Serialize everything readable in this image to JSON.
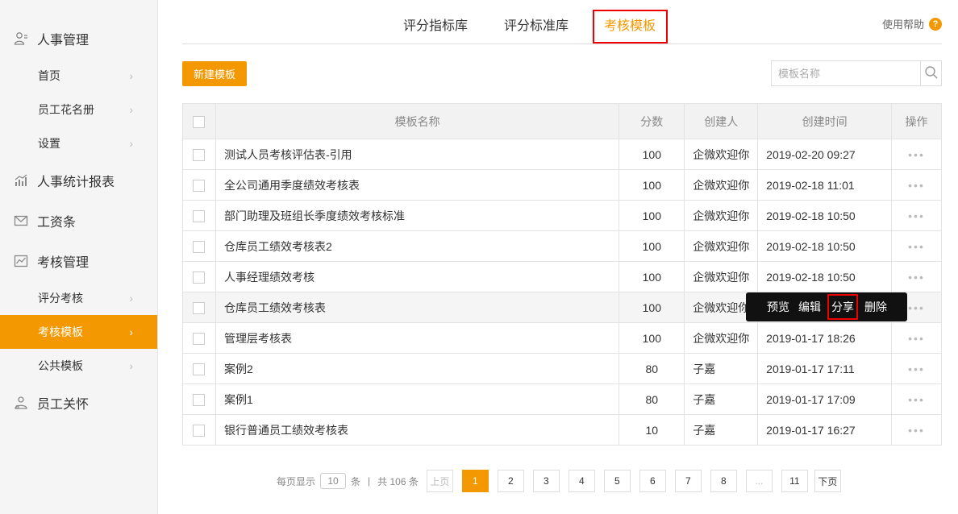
{
  "sidebar": {
    "groups": [
      {
        "label": "人事管理",
        "icon": "person-icon",
        "items": [
          {
            "label": "首页"
          },
          {
            "label": "员工花名册"
          },
          {
            "label": "设置"
          }
        ]
      },
      {
        "label": "人事统计报表",
        "icon": "bar-chart-icon"
      },
      {
        "label": "工资条",
        "icon": "envelope-icon"
      },
      {
        "label": "考核管理",
        "icon": "line-chart-icon",
        "items": [
          {
            "label": "评分考核"
          },
          {
            "label": "考核模板",
            "active": true
          },
          {
            "label": "公共模板"
          }
        ]
      },
      {
        "label": "员工关怀",
        "icon": "care-person-icon"
      }
    ]
  },
  "tabs": [
    {
      "label": "评分指标库"
    },
    {
      "label": "评分标准库"
    },
    {
      "label": "考核模板",
      "active": true
    }
  ],
  "help": {
    "label": "使用帮助",
    "icon": "question-icon"
  },
  "toolbar": {
    "new_label": "新建模板",
    "search_placeholder": "模板名称"
  },
  "table": {
    "columns": [
      "模板名称",
      "分数",
      "创建人",
      "创建时间",
      "操作"
    ],
    "rows": [
      {
        "name": "测试人员考核评估表-引用",
        "score": "100",
        "creator": "企微欢迎你",
        "time": "2019-02-20 09:27"
      },
      {
        "name": "全公司通用季度绩效考核表",
        "score": "100",
        "creator": "企微欢迎你",
        "time": "2019-02-18 11:01"
      },
      {
        "name": "部门助理及班组长季度绩效考核标准",
        "score": "100",
        "creator": "企微欢迎你",
        "time": "2019-02-18 10:50"
      },
      {
        "name": "仓库员工绩效考核表2",
        "score": "100",
        "creator": "企微欢迎你",
        "time": "2019-02-18 10:50"
      },
      {
        "name": "人事经理绩效考核",
        "score": "100",
        "creator": "企微欢迎你",
        "time": "2019-02-18 10:50"
      },
      {
        "name": "仓库员工绩效考核表",
        "score": "100",
        "creator": "企微欢迎你",
        "time": ""
      },
      {
        "name": "管理层考核表",
        "score": "100",
        "creator": "企微欢迎你",
        "time": "2019-01-17 18:26"
      },
      {
        "name": "案例2",
        "score": "80",
        "creator": "子嘉",
        "time": "2019-01-17 17:11"
      },
      {
        "name": "案例1",
        "score": "80",
        "creator": "子嘉",
        "time": "2019-01-17 17:09"
      },
      {
        "name": "银行普通员工绩效考核表",
        "score": "10",
        "creator": "子嘉",
        "time": "2019-01-17 16:27"
      }
    ],
    "op_dots": "•••"
  },
  "popup_menu": {
    "items": [
      "预览",
      "编辑",
      "分享",
      "删除"
    ]
  },
  "pagination": {
    "per_page_label": "每页显示",
    "per_page": "10",
    "unit": "条",
    "divider": "|",
    "total_label": "共 106 条",
    "prev": "上页",
    "pages": [
      "1",
      "2",
      "3",
      "4",
      "5",
      "6",
      "7",
      "8",
      "...",
      "11"
    ],
    "current": "1",
    "next": "下页"
  },
  "colors": {
    "accent": "#f39800",
    "highlight_border": "#e00000",
    "popup_bg": "#111111"
  }
}
